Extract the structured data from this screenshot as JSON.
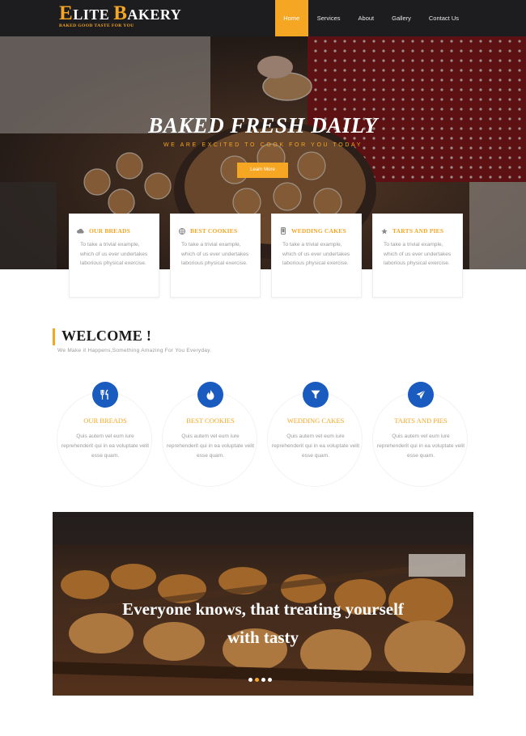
{
  "brand": {
    "first_initial": "E",
    "first_rest": "LITE",
    "second_initial": "B",
    "second_rest": "AKERY",
    "tagline": "BAKED GOOD TASTE FOR YOU"
  },
  "nav": {
    "items": [
      {
        "label": "Home",
        "active": true
      },
      {
        "label": "Services",
        "active": false
      },
      {
        "label": "About",
        "active": false
      },
      {
        "label": "Gallery",
        "active": false
      },
      {
        "label": "Contact Us",
        "active": false
      }
    ]
  },
  "hero": {
    "title": "BAKED FRESH DAILY",
    "subtitle": "WE ARE EXCITED TO COOK FOR YOU TODAY",
    "button_label": "Learn More"
  },
  "features": [
    {
      "title": "OUR BREADS",
      "icon": "cloud-icon",
      "text": "To take a trivial example, which of us ever undertakes laborious physical exercise."
    },
    {
      "title": "BEST COOKIES",
      "icon": "globe-icon",
      "text": "To take a trivial example, which of us ever undertakes laborious physical exercise."
    },
    {
      "title": "WEDDING CAKES",
      "icon": "phone-icon",
      "text": "To take a trivial example, which of us ever undertakes laborious physical exercise."
    },
    {
      "title": "TARTS AND PIES",
      "icon": "star-icon",
      "text": "To take a trivial example, which of us ever undertakes laborious physical exercise."
    }
  ],
  "welcome": {
    "title": "WELCOME !",
    "subtitle": "We Make it Happens,Something Amazing For You Everyday."
  },
  "services": [
    {
      "title": "OUR BREADS",
      "icon": "cutlery-icon",
      "text": "Quis autem vel eum iure reprehenderit qui in ea voluptate velit esse quam."
    },
    {
      "title": "BEST COOKIES",
      "icon": "fire-icon",
      "text": "Quis autem vel eum iure reprehenderit qui in ea voluptate velit esse quam."
    },
    {
      "title": "WEDDING CAKES",
      "icon": "funnel-icon",
      "text": "Quis autem vel eum iure reprehenderit qui in ea voluptate velit esse quam."
    },
    {
      "title": "TARTS AND PIES",
      "icon": "send-icon",
      "text": "Quis autem vel eum iure reprehenderit qui in ea voluptate velit esse quam."
    }
  ],
  "banner": {
    "line1": "Everyone knows, that treating yourself",
    "line2": "with tasty",
    "slide_count": 4,
    "active_slide": 2
  },
  "colors": {
    "accent": "#f5a623",
    "nav_bg": "#1d1d1f",
    "service_icon_bg": "#1a5bbf"
  }
}
